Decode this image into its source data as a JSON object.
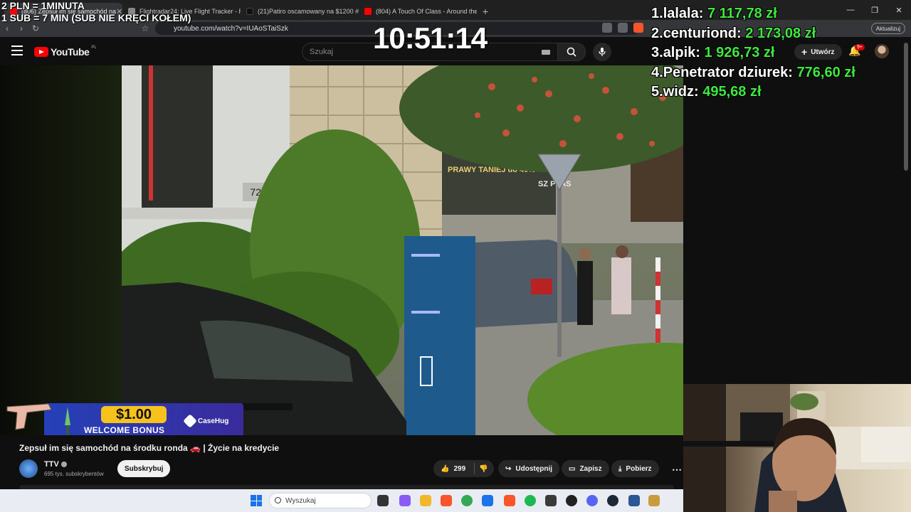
{
  "browser": {
    "tabs": [
      {
        "label": "(806) Zepsuł im się samochód na",
        "active": true,
        "favicon_color": "#ff0000"
      },
      {
        "label": "Flightradar24: Live Flight Tracker - Re",
        "active": false,
        "favicon_color": "#888888"
      },
      {
        "label": "(21)Patiro oscamowany na $1200 #pa",
        "active": false,
        "favicon_color": "#111111"
      },
      {
        "label": "(804) A Touch Of Class - Around the",
        "active": false,
        "favicon_color": "#ff0000"
      }
    ],
    "url": "youtube.com/watch?v=IUAoSTaiSzk",
    "update_label": "Aktualizuj"
  },
  "youtube": {
    "logo_text": "YouTube",
    "region": "PL",
    "search_placeholder": "Szukaj",
    "create_label": "Utwórz",
    "notif_count": "9+"
  },
  "overlay": {
    "promo_lines": [
      "2 PLN = 1MINUTA",
      "1 SUB = 7 MIN (SUB NIE KRĘCI KOŁEM)"
    ],
    "clock": "10:51:14",
    "leaderboard": [
      {
        "rank": "1.",
        "name": "lalala:",
        "amount": "7 117,78 zł"
      },
      {
        "rank": "2.",
        "name": "centuriond:",
        "amount": "2 173,08 zł"
      },
      {
        "rank": "3.",
        "name": "alpik:",
        "amount": "1 926,73 zł"
      },
      {
        "rank": "4.",
        "name": "Penetrator dziurek:",
        "amount": "776,60 zł"
      },
      {
        "rank": "5.",
        "name": "widz:",
        "amount": "495,68 zł"
      }
    ],
    "casehug": {
      "amount": "$1.00",
      "bonus": "WELCOME BONUS",
      "brand": "CaseHug"
    }
  },
  "video_scene": {
    "house_number": "7273",
    "shop_sign": "PRAWY TANIEJ do 40%",
    "shop_sign_right": "SZ PLAS"
  },
  "video": {
    "title": "Zepsuł im się samochód na środku ronda 🚗 | Życie na kredycie",
    "channel": "TTV",
    "subscribers": "695 tys. subskrybentów",
    "subscribe_label": "Subskrybuj",
    "likes": "299",
    "share_label": "Udostępnij",
    "save_label": "Zapisz",
    "download_label": "Pobierz"
  },
  "taskbar": {
    "search_placeholder": "Wyszukaj",
    "apps": [
      {
        "name": "task-view-icon",
        "color": "#333333"
      },
      {
        "name": "copilot-icon",
        "color": "#8a5cf6"
      },
      {
        "name": "file-explorer-icon",
        "color": "#f3b82a"
      },
      {
        "name": "brave-icon",
        "color": "#fb542b"
      },
      {
        "name": "chrome-icon",
        "color": "#34a853"
      },
      {
        "name": "store-icon",
        "color": "#1a73e8"
      },
      {
        "name": "brave-active-icon",
        "color": "#fb542b"
      },
      {
        "name": "spotify-icon",
        "color": "#1db954"
      },
      {
        "name": "calculator-icon",
        "color": "#3a3a3a"
      },
      {
        "name": "obs-icon",
        "color": "#222222"
      },
      {
        "name": "discord-icon",
        "color": "#5865f2"
      },
      {
        "name": "steam-icon",
        "color": "#1b2838"
      },
      {
        "name": "app-icon",
        "color": "#2b5797"
      },
      {
        "name": "app2-icon",
        "color": "#c89b3c"
      }
    ]
  }
}
